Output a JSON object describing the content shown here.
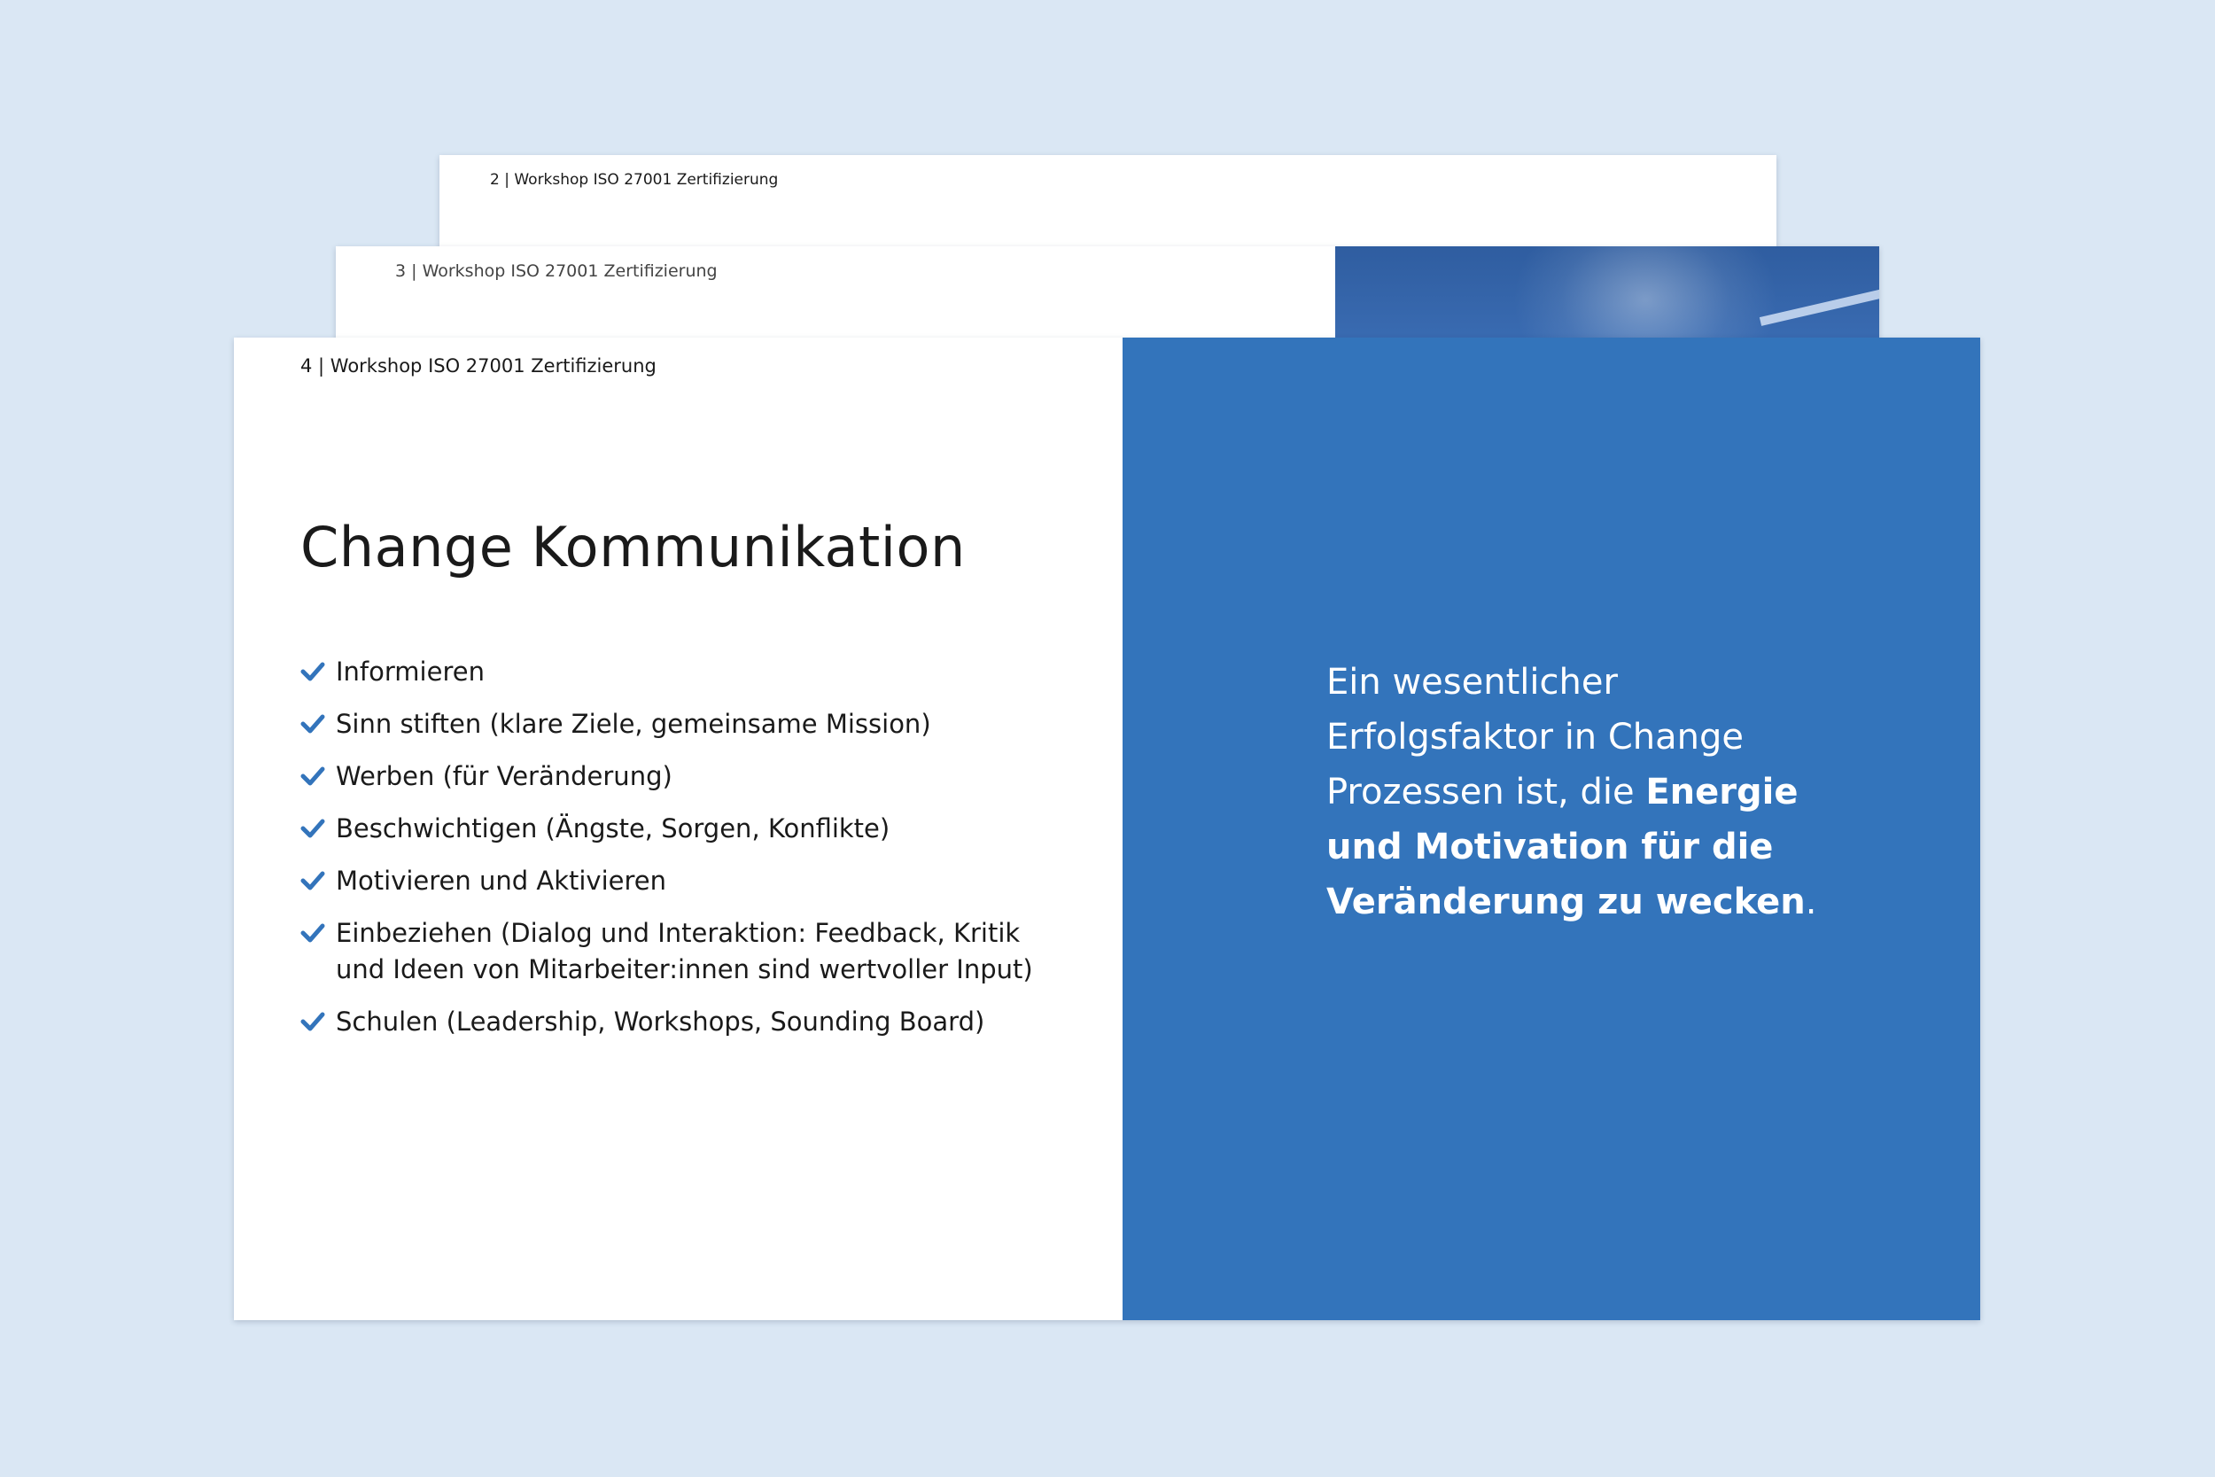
{
  "background_color": "#dae7f4",
  "accent_color": "#3374bb",
  "slides": [
    {
      "header": "2 | Workshop ISO 27001 Zertifizierung"
    },
    {
      "header": "3 | Workshop ISO 27001 Zertifizierung"
    },
    {
      "header": "4 | Workshop ISO 27001 Zertifizierung",
      "title": "Change Kommunikation",
      "bullet_icon": "checkmark-icon",
      "bullets": [
        [
          "Informieren"
        ],
        [
          "Sinn stiften (klare Ziele, gemeinsame Mission)"
        ],
        [
          "Werben (für Veränderung)"
        ],
        [
          "Beschwichtigen (Ängste, Sorgen, Konflikte)"
        ],
        [
          "Motivieren und Aktivieren"
        ],
        [
          "Einbeziehen (Dialog und Interaktion: Feedback, Kritik",
          "und Ideen von Mitarbeiter:innen sind wertvoller Input)"
        ],
        [
          "Schulen (Leadership, Workshops, Sounding Board)"
        ]
      ],
      "quote": {
        "line1": "Ein wesentlicher",
        "line2": "Erfolgsfaktor in Change",
        "line3_plain": "Prozessen ist, die ",
        "line3_bold": "Energie",
        "line4_bold": "und Motivation für die",
        "line5_bold": "Veränderung zu wecken",
        "line5_end": "."
      }
    }
  ]
}
